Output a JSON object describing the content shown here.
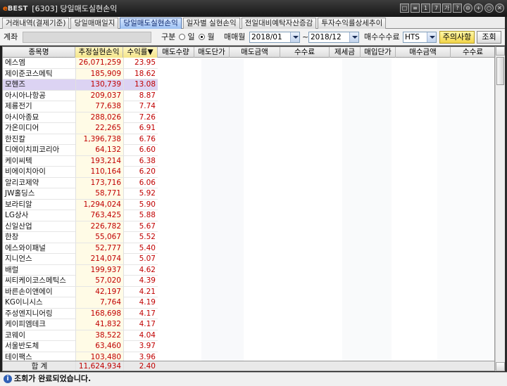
{
  "window": {
    "logo_prefix": "e",
    "logo_text": "BEST",
    "title": "[6303] 당일매도실현손익"
  },
  "title_buttons": [
    "□",
    "≡",
    "1",
    "7",
    "가",
    "?",
    "⊖",
    "+",
    "○",
    "✕"
  ],
  "tabs": [
    {
      "label": "거래내역(결제기준)",
      "active": false
    },
    {
      "label": "당일매매일지",
      "active": false
    },
    {
      "label": "당일매도실현손익",
      "active": true
    },
    {
      "label": "일자별 실현손익",
      "active": false
    },
    {
      "label": "전일대비예탁자산증감",
      "active": false
    },
    {
      "label": "투자수익률상세추이",
      "active": false
    }
  ],
  "toolbar": {
    "account_label": "계좌",
    "type_label": "구분",
    "radio_day": "일",
    "radio_month": "월",
    "selected": "월",
    "trade_month_label": "매매월",
    "from_month": "2018/01",
    "tilde": "~",
    "to_month": "2018/12",
    "fee_label": "매수수수료",
    "fee_value": "HTS",
    "notice_button": "주의사항",
    "query_button": "조회"
  },
  "table": {
    "columns": [
      "종목명",
      "추정실현손익",
      "수익률▼",
      "매도수량",
      "매도단가",
      "매도금액",
      "수수료",
      "제세금",
      "매입단가",
      "매수금액",
      "수수료"
    ],
    "rows": [
      {
        "name": "에스엠",
        "pnl": "26,071,259",
        "rate": "23.95"
      },
      {
        "name": "제이준코스메틱",
        "pnl": "185,909",
        "rate": "18.62"
      },
      {
        "name": "모헨즈",
        "pnl": "130,739",
        "rate": "13.08",
        "selected": true
      },
      {
        "name": "아시아나항공",
        "pnl": "209,037",
        "rate": "8.87"
      },
      {
        "name": "제룡전기",
        "pnl": "77,638",
        "rate": "7.74"
      },
      {
        "name": "아시아종묘",
        "pnl": "288,026",
        "rate": "7.26"
      },
      {
        "name": "가온미디어",
        "pnl": "22,265",
        "rate": "6.91"
      },
      {
        "name": "한진칼",
        "pnl": "1,396,738",
        "rate": "6.76"
      },
      {
        "name": "디에이치피코리아",
        "pnl": "64,132",
        "rate": "6.60"
      },
      {
        "name": "케이씨텍",
        "pnl": "193,214",
        "rate": "6.38"
      },
      {
        "name": "비에이치아이",
        "pnl": "110,164",
        "rate": "6.20"
      },
      {
        "name": "알리코제약",
        "pnl": "173,716",
        "rate": "6.06"
      },
      {
        "name": "JW홀딩스",
        "pnl": "58,771",
        "rate": "5.92"
      },
      {
        "name": "보라티알",
        "pnl": "1,294,024",
        "rate": "5.90"
      },
      {
        "name": "LG상사",
        "pnl": "763,425",
        "rate": "5.88"
      },
      {
        "name": "신일산업",
        "pnl": "226,782",
        "rate": "5.67"
      },
      {
        "name": "한창",
        "pnl": "55,067",
        "rate": "5.52"
      },
      {
        "name": "에스와이패널",
        "pnl": "52,777",
        "rate": "5.40"
      },
      {
        "name": "지니언스",
        "pnl": "214,074",
        "rate": "5.07"
      },
      {
        "name": "배럴",
        "pnl": "199,937",
        "rate": "4.62"
      },
      {
        "name": "씨티케이코스메틱스",
        "pnl": "57,020",
        "rate": "4.39"
      },
      {
        "name": "바른손이앤에이",
        "pnl": "42,197",
        "rate": "4.21"
      },
      {
        "name": "KG이니시스",
        "pnl": "7,764",
        "rate": "4.19"
      },
      {
        "name": "주성엔지니어링",
        "pnl": "168,698",
        "rate": "4.17"
      },
      {
        "name": "케이피엠테크",
        "pnl": "41,832",
        "rate": "4.17"
      },
      {
        "name": "코웨이",
        "pnl": "38,522",
        "rate": "4.04"
      },
      {
        "name": "서울반도체",
        "pnl": "63,460",
        "rate": "3.97"
      },
      {
        "name": "테이팩스",
        "pnl": "103,480",
        "rate": "3.96"
      }
    ],
    "total": {
      "label": "합 계",
      "pnl": "11,624,934",
      "rate": "2.40"
    }
  },
  "status": {
    "icon": "i",
    "message": "조회가 완료되었습니다."
  }
}
